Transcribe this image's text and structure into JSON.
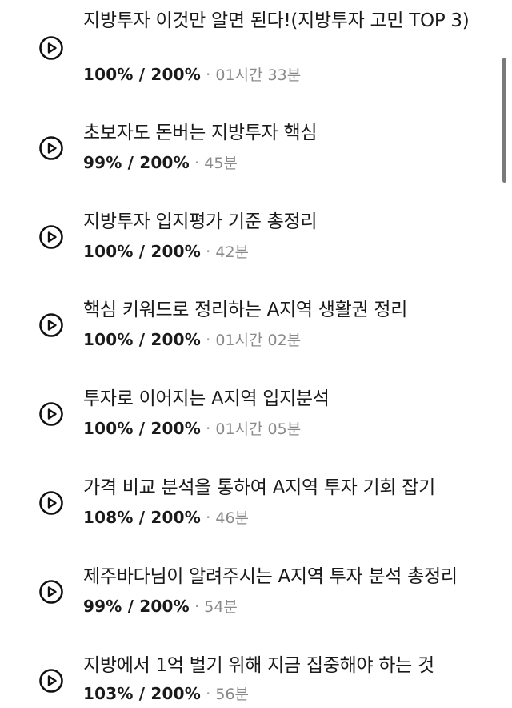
{
  "lectures": [
    {
      "title": "지방투자 이것만 알면 된다!(지방투자 고민 TOP 3)",
      "progress": "100% / 200%",
      "duration": "01시간 33분"
    },
    {
      "title": "초보자도 돈버는 지방투자 핵심",
      "progress": "99% / 200%",
      "duration": "45분"
    },
    {
      "title": "지방투자 입지평가 기준 총정리",
      "progress": "100% / 200%",
      "duration": "42분"
    },
    {
      "title": "핵심 키워드로 정리하는 A지역 생활권 정리",
      "progress": "100% / 200%",
      "duration": "01시간 02분"
    },
    {
      "title": "투자로 이어지는 A지역 입지분석",
      "progress": "100% / 200%",
      "duration": "01시간 05분"
    },
    {
      "title": "가격 비교 분석을 통하여 A지역 투자 기회 잡기",
      "progress": "108% / 200%",
      "duration": "46분"
    },
    {
      "title": "제주바다님이 알려주시는 A지역 투자 분석 총정리",
      "progress": "99% / 200%",
      "duration": "54분"
    },
    {
      "title": "지방에서 1억 벌기 위해 지금 집중해야 하는 것",
      "progress": "103% / 200%",
      "duration": "56분"
    }
  ],
  "meta_separator": "·",
  "icons": {
    "play": "play-circle-icon"
  },
  "colors": {
    "text": "#1a1a1a",
    "muted": "#8a8a8a",
    "scrollbar": "#7a7a7a"
  }
}
